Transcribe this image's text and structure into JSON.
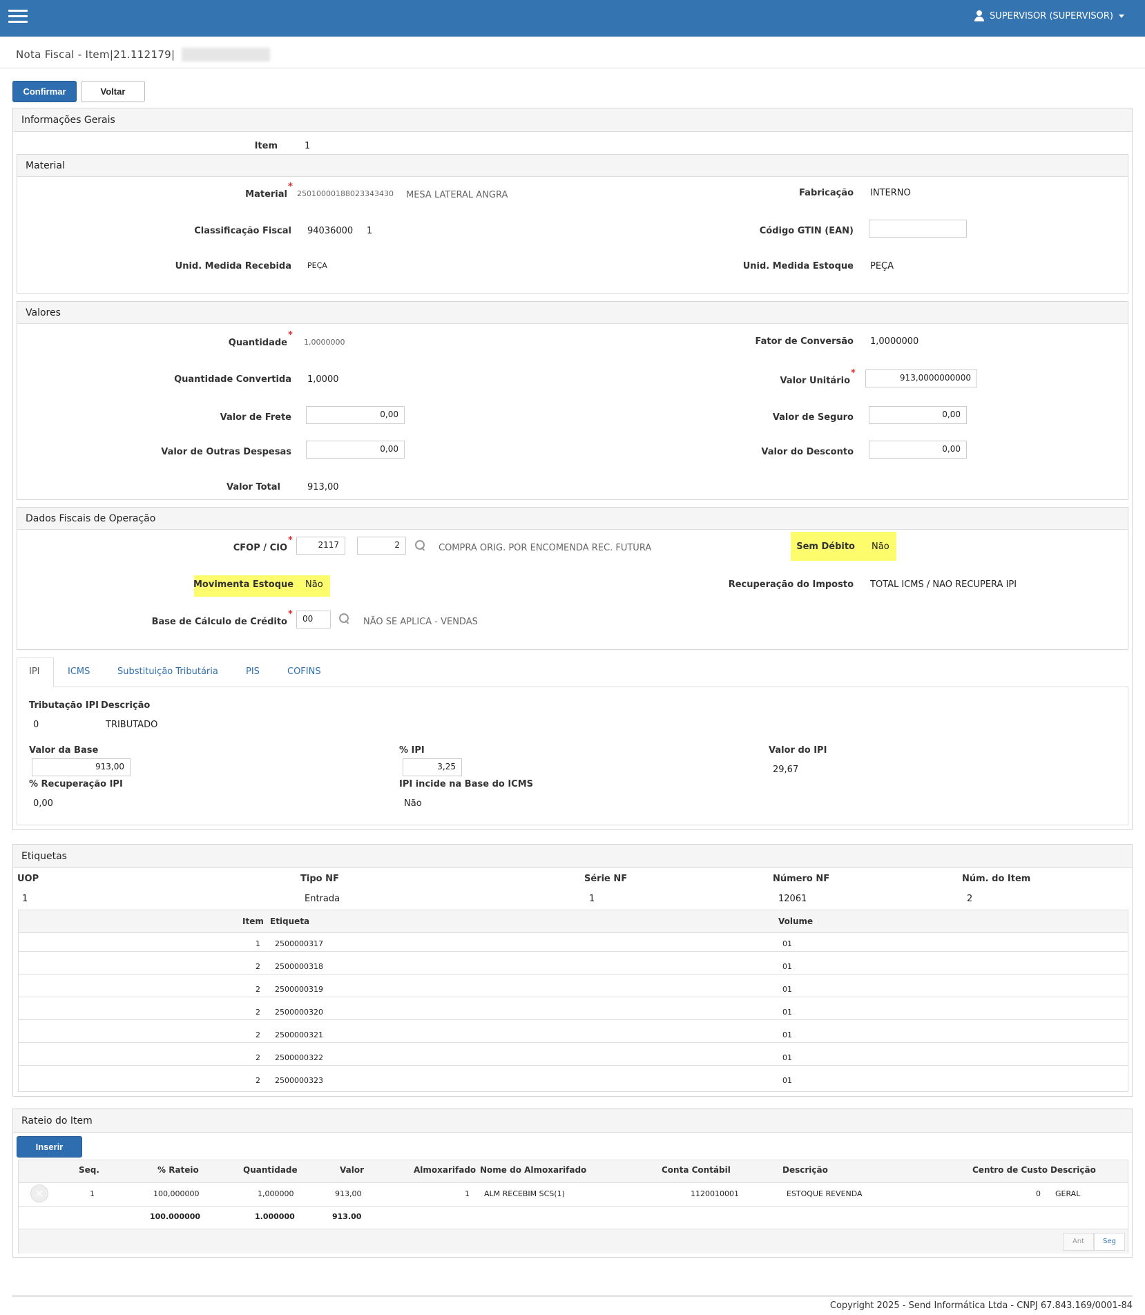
{
  "header": {
    "user": "SUPERVISOR (SUPERVISOR)"
  },
  "page": {
    "title": "Nota Fiscal - Item|21.112179|"
  },
  "toolbar": {
    "confirm": "Confirmar",
    "back": "Voltar"
  },
  "info": {
    "title": "Informações Gerais",
    "item_label": "Item",
    "item_value": "1",
    "material": {
      "title": "Material",
      "material_label": "Material",
      "material_code": "25010000188023343430",
      "material_name": "MESA LATERAL ANGRA",
      "fabricacao_label": "Fabricação",
      "fabricacao_value": "INTERNO",
      "classificacao_label": "Classificação Fiscal",
      "classificacao_value": "94036000",
      "classificacao_extra": "1",
      "gtin_label": "Código GTIN (EAN)",
      "gtin_value": "",
      "unid_receb_label": "Unid. Medida Recebida",
      "unid_receb_value": "PEÇA",
      "unid_estoque_label": "Unid. Medida Estoque",
      "unid_estoque_value": "PEÇA"
    },
    "valores": {
      "title": "Valores",
      "quantidade_label": "Quantidade",
      "quantidade_value": "1,0000000",
      "fator_label": "Fator de Conversão",
      "fator_value": "1,0000000",
      "qtd_conv_label": "Quantidade Convertida",
      "qtd_conv_value": "1,0000",
      "valor_unit_label": "Valor Unitário",
      "valor_unit_value": "913,0000000000",
      "frete_label": "Valor de Frete",
      "frete_value": "0,00",
      "seguro_label": "Valor de Seguro",
      "seguro_value": "0,00",
      "outras_label": "Valor de Outras Despesas",
      "outras_value": "0,00",
      "desconto_label": "Valor do Desconto",
      "desconto_value": "0,00",
      "total_label": "Valor Total",
      "total_value": "913,00"
    },
    "fiscal": {
      "title": "Dados Fiscais de Operação",
      "cfop_label": "CFOP / CIO",
      "cfop_value": "2117",
      "cio_value": "2",
      "cfop_desc": "COMPRA ORIG. POR ENCOMENDA REC. FUTURA",
      "sem_debito_label": "Sem Débito",
      "sem_debito_value": "Não",
      "mov_estoque_label": "Movimenta Estoque",
      "mov_estoque_value": "Não",
      "recuperacao_label": "Recuperação do Imposto",
      "recuperacao_value": "TOTAL ICMS / NAO RECUPERA IPI",
      "base_label": "Base de Cálculo de Crédito",
      "base_value": "00",
      "base_desc": "NÃO SE APLICA - VENDAS"
    },
    "tabs": [
      "IPI",
      "ICMS",
      "Substituição Tributária",
      "PIS",
      "COFINS"
    ],
    "ipi": {
      "trib_label": "Tributação IPI",
      "desc_label": "Descrição",
      "trib_value": "0",
      "desc_value": "TRIBUTADO",
      "base_label": "Valor da Base",
      "base_value": "913,00",
      "pct_label": "% IPI",
      "pct_value": "3,25",
      "valor_label": "Valor do IPI",
      "valor_value": "29,67",
      "recup_label": "% Recuperação IPI",
      "recup_value": "0,00",
      "incide_label": "IPI incide na Base do ICMS",
      "incide_value": "Não"
    }
  },
  "etiquetas": {
    "title": "Etiquetas",
    "headers": [
      "UOP",
      "Tipo NF",
      "Série NF",
      "Número NF",
      "Núm. do Item"
    ],
    "values": [
      "1",
      "Entrada",
      "1",
      "12061",
      "2"
    ],
    "table_headers": [
      "Item",
      "Etiqueta",
      "Volume"
    ],
    "rows": [
      [
        "1",
        "2500000317",
        "01"
      ],
      [
        "2",
        "2500000318",
        "01"
      ],
      [
        "2",
        "2500000319",
        "01"
      ],
      [
        "2",
        "2500000320",
        "01"
      ],
      [
        "2",
        "2500000321",
        "01"
      ],
      [
        "2",
        "2500000322",
        "01"
      ],
      [
        "2",
        "2500000323",
        "01"
      ]
    ]
  },
  "rateio": {
    "title": "Rateio do Item",
    "insert": "Inserir",
    "headers": [
      "Seq.",
      "% Rateio",
      "Quantidade",
      "Valor",
      "Almoxarifado",
      "Nome do Almoxarifado",
      "Conta Contábil",
      "Descrição",
      "Centro de Custo",
      "Descrição"
    ],
    "row": [
      "1",
      "100,000000",
      "1,000000",
      "913,00",
      "1",
      "ALM RECEBIM SCS(1)",
      "1120010001",
      "ESTOQUE REVENDA",
      "0",
      "GERAL"
    ],
    "totals": [
      "100.000000",
      "1.000000",
      "913.00"
    ],
    "pager_prev": "Ant",
    "pager_next": "Seg"
  },
  "footer": {
    "copyright": "Copyright 2025 - Send Informática Ltda - CNPJ 67.843.169/0001-84"
  }
}
